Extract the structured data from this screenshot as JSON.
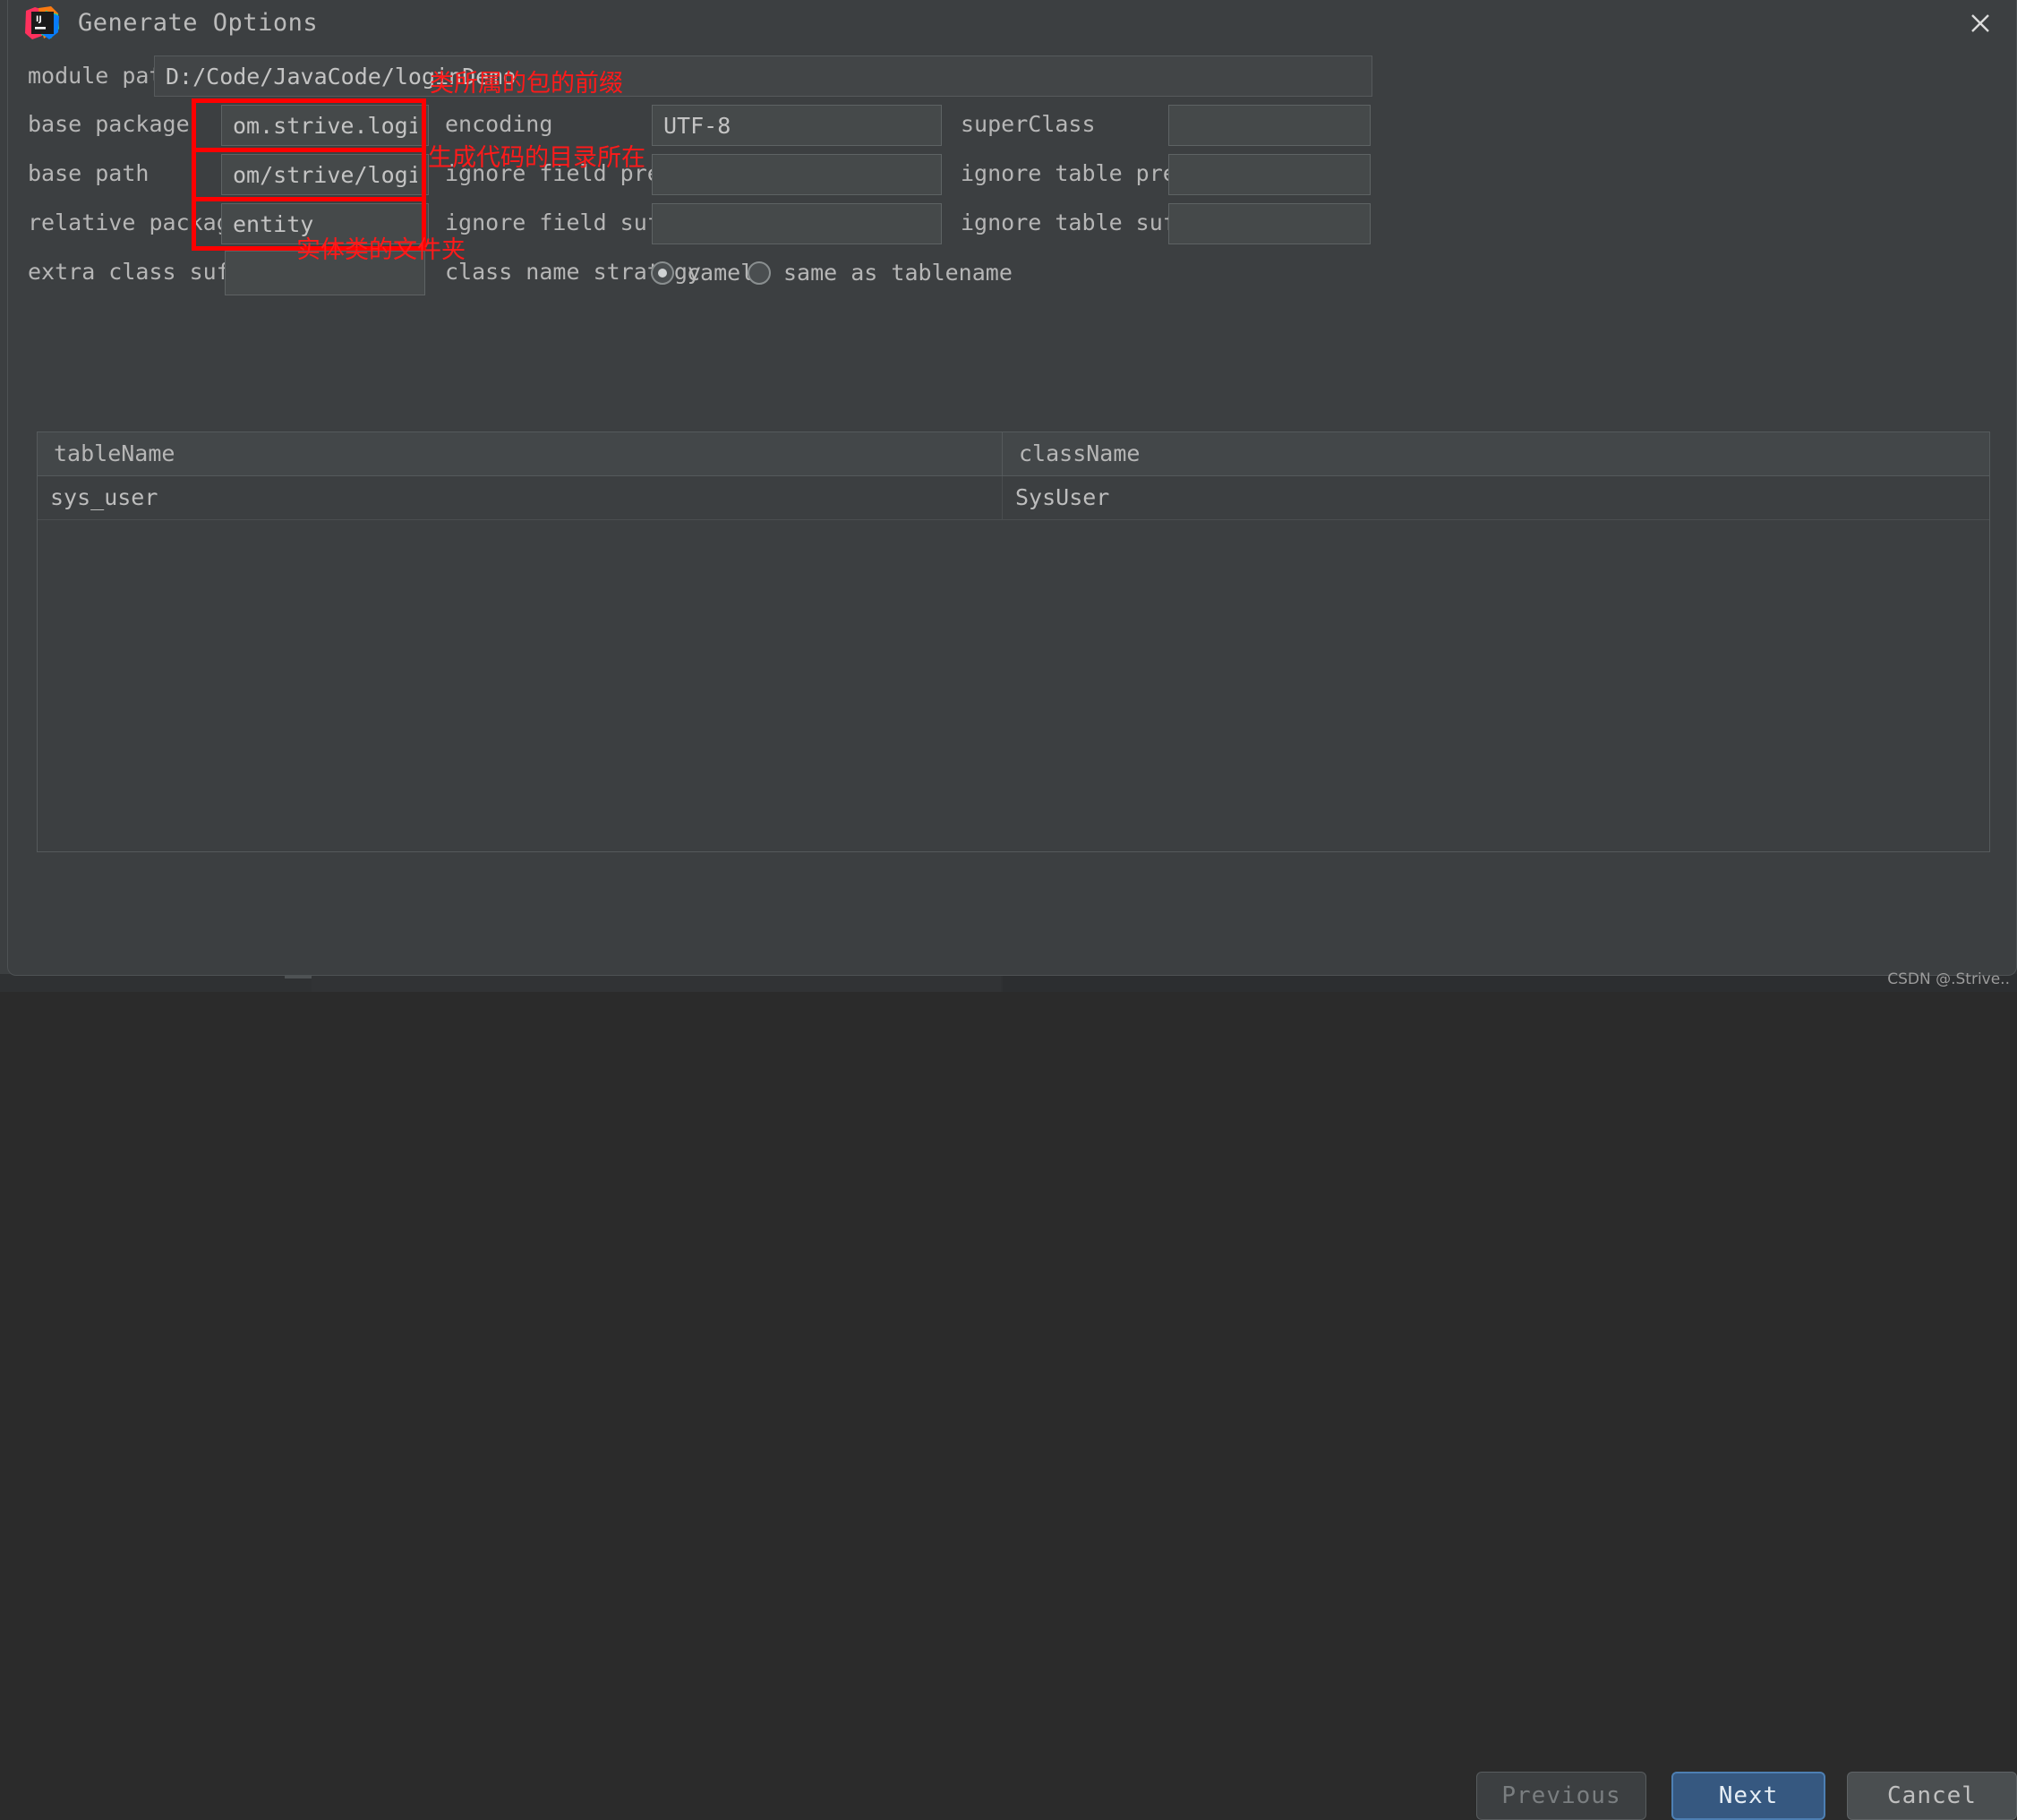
{
  "window": {
    "title": "Generate Options",
    "app_icon": "intellij-idea-logo",
    "close_icon": "close-icon"
  },
  "form": {
    "module_path": {
      "label": "module path",
      "value": "D:/Code/JavaCode/loginDemo"
    },
    "base_package": {
      "label": "base package",
      "value": "om.strive.logindemo"
    },
    "base_path": {
      "label": "base path",
      "value": "om/strive/logindemo"
    },
    "relative_package": {
      "label": "relative package",
      "value": "entity"
    },
    "extra_class_suffix": {
      "label": "extra class suffix",
      "value": ""
    },
    "encoding": {
      "label": "encoding",
      "value": "UTF-8"
    },
    "ignore_field_prefix": {
      "label": "ignore field prefix",
      "value": ""
    },
    "ignore_field_suffix": {
      "label": "ignore field suffix",
      "value": ""
    },
    "super_class": {
      "label": "superClass",
      "value": ""
    },
    "ignore_table_prefix": {
      "label": "ignore table prefix",
      "value": ""
    },
    "ignore_table_suffix": {
      "label": "ignore table suffix",
      "value": ""
    },
    "class_name_strategy": {
      "label": "class name strategy",
      "selected": "camel",
      "options": [
        {
          "value": "camel",
          "label": "camel",
          "selected": true
        },
        {
          "value": "same_as_tablename",
          "label": "same as tablename",
          "selected": false
        }
      ]
    }
  },
  "annotations": {
    "color": "#ff0000",
    "items": [
      {
        "text": "类所属的包的前缀",
        "target": "base package"
      },
      {
        "text": "生成代码的目录所在",
        "target": "base path"
      },
      {
        "text": "实体类的文件夹",
        "target": "relative package"
      }
    ]
  },
  "table": {
    "columns": [
      "tableName",
      "className"
    ],
    "rows": [
      {
        "tableName": "sys_user",
        "className": "SysUser"
      }
    ]
  },
  "footer": {
    "previous_label": "Previous",
    "next_label": "Next",
    "cancel_label": "Cancel",
    "watermark": "CSDN @.Strive.."
  },
  "colors": {
    "dialog_bg": "#3c3f41",
    "input_bg": "#45494a",
    "text": "#b6b6b6",
    "accent_blue": "#365880",
    "annotation_red": "#ff0000"
  }
}
